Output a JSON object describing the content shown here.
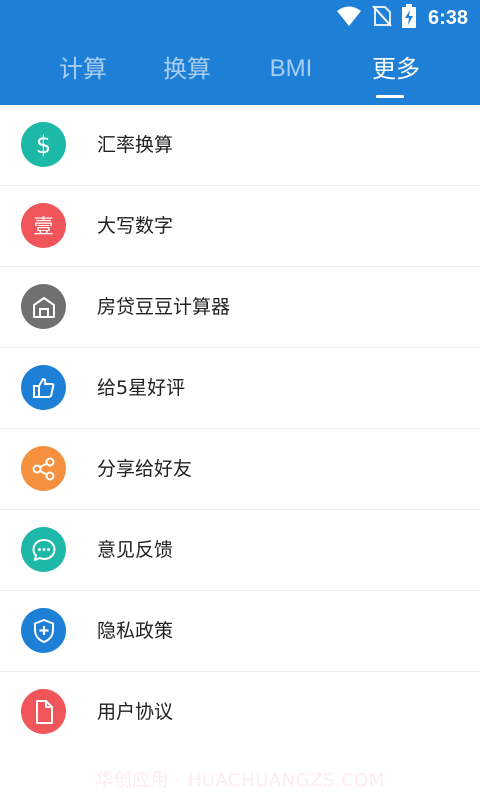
{
  "status_bar": {
    "time": "6:38",
    "icons": [
      "wifi-icon",
      "no-sim-icon",
      "battery-charging-icon"
    ]
  },
  "tabs": [
    {
      "label": "计算",
      "active": false
    },
    {
      "label": "换算",
      "active": false
    },
    {
      "label": "BMI",
      "active": false
    },
    {
      "label": "更多",
      "active": true
    }
  ],
  "items": [
    {
      "label": "汇率换算",
      "icon": "dollar-icon",
      "color": "#1db8a8",
      "glyph": "$"
    },
    {
      "label": "大写数字",
      "icon": "chinese-numeral-icon",
      "color": "#f0555a",
      "glyph": "壹"
    },
    {
      "label": "房贷豆豆计算器",
      "icon": "house-icon",
      "color": "#707070"
    },
    {
      "label": "给5星好评",
      "icon": "thumbs-up-icon",
      "color": "#1e7fd6"
    },
    {
      "label": "分享给好友",
      "icon": "share-icon",
      "color": "#f5913e"
    },
    {
      "label": "意见反馈",
      "icon": "chat-bubble-icon",
      "color": "#1db8a8"
    },
    {
      "label": "隐私政策",
      "icon": "shield-icon",
      "color": "#1e7fd6"
    },
    {
      "label": "用户协议",
      "icon": "document-icon",
      "color": "#f0555a"
    }
  ],
  "watermark": "华创应用 · HUACHUANGZS.COM",
  "theme": {
    "header_color": "#1e7fd6"
  }
}
